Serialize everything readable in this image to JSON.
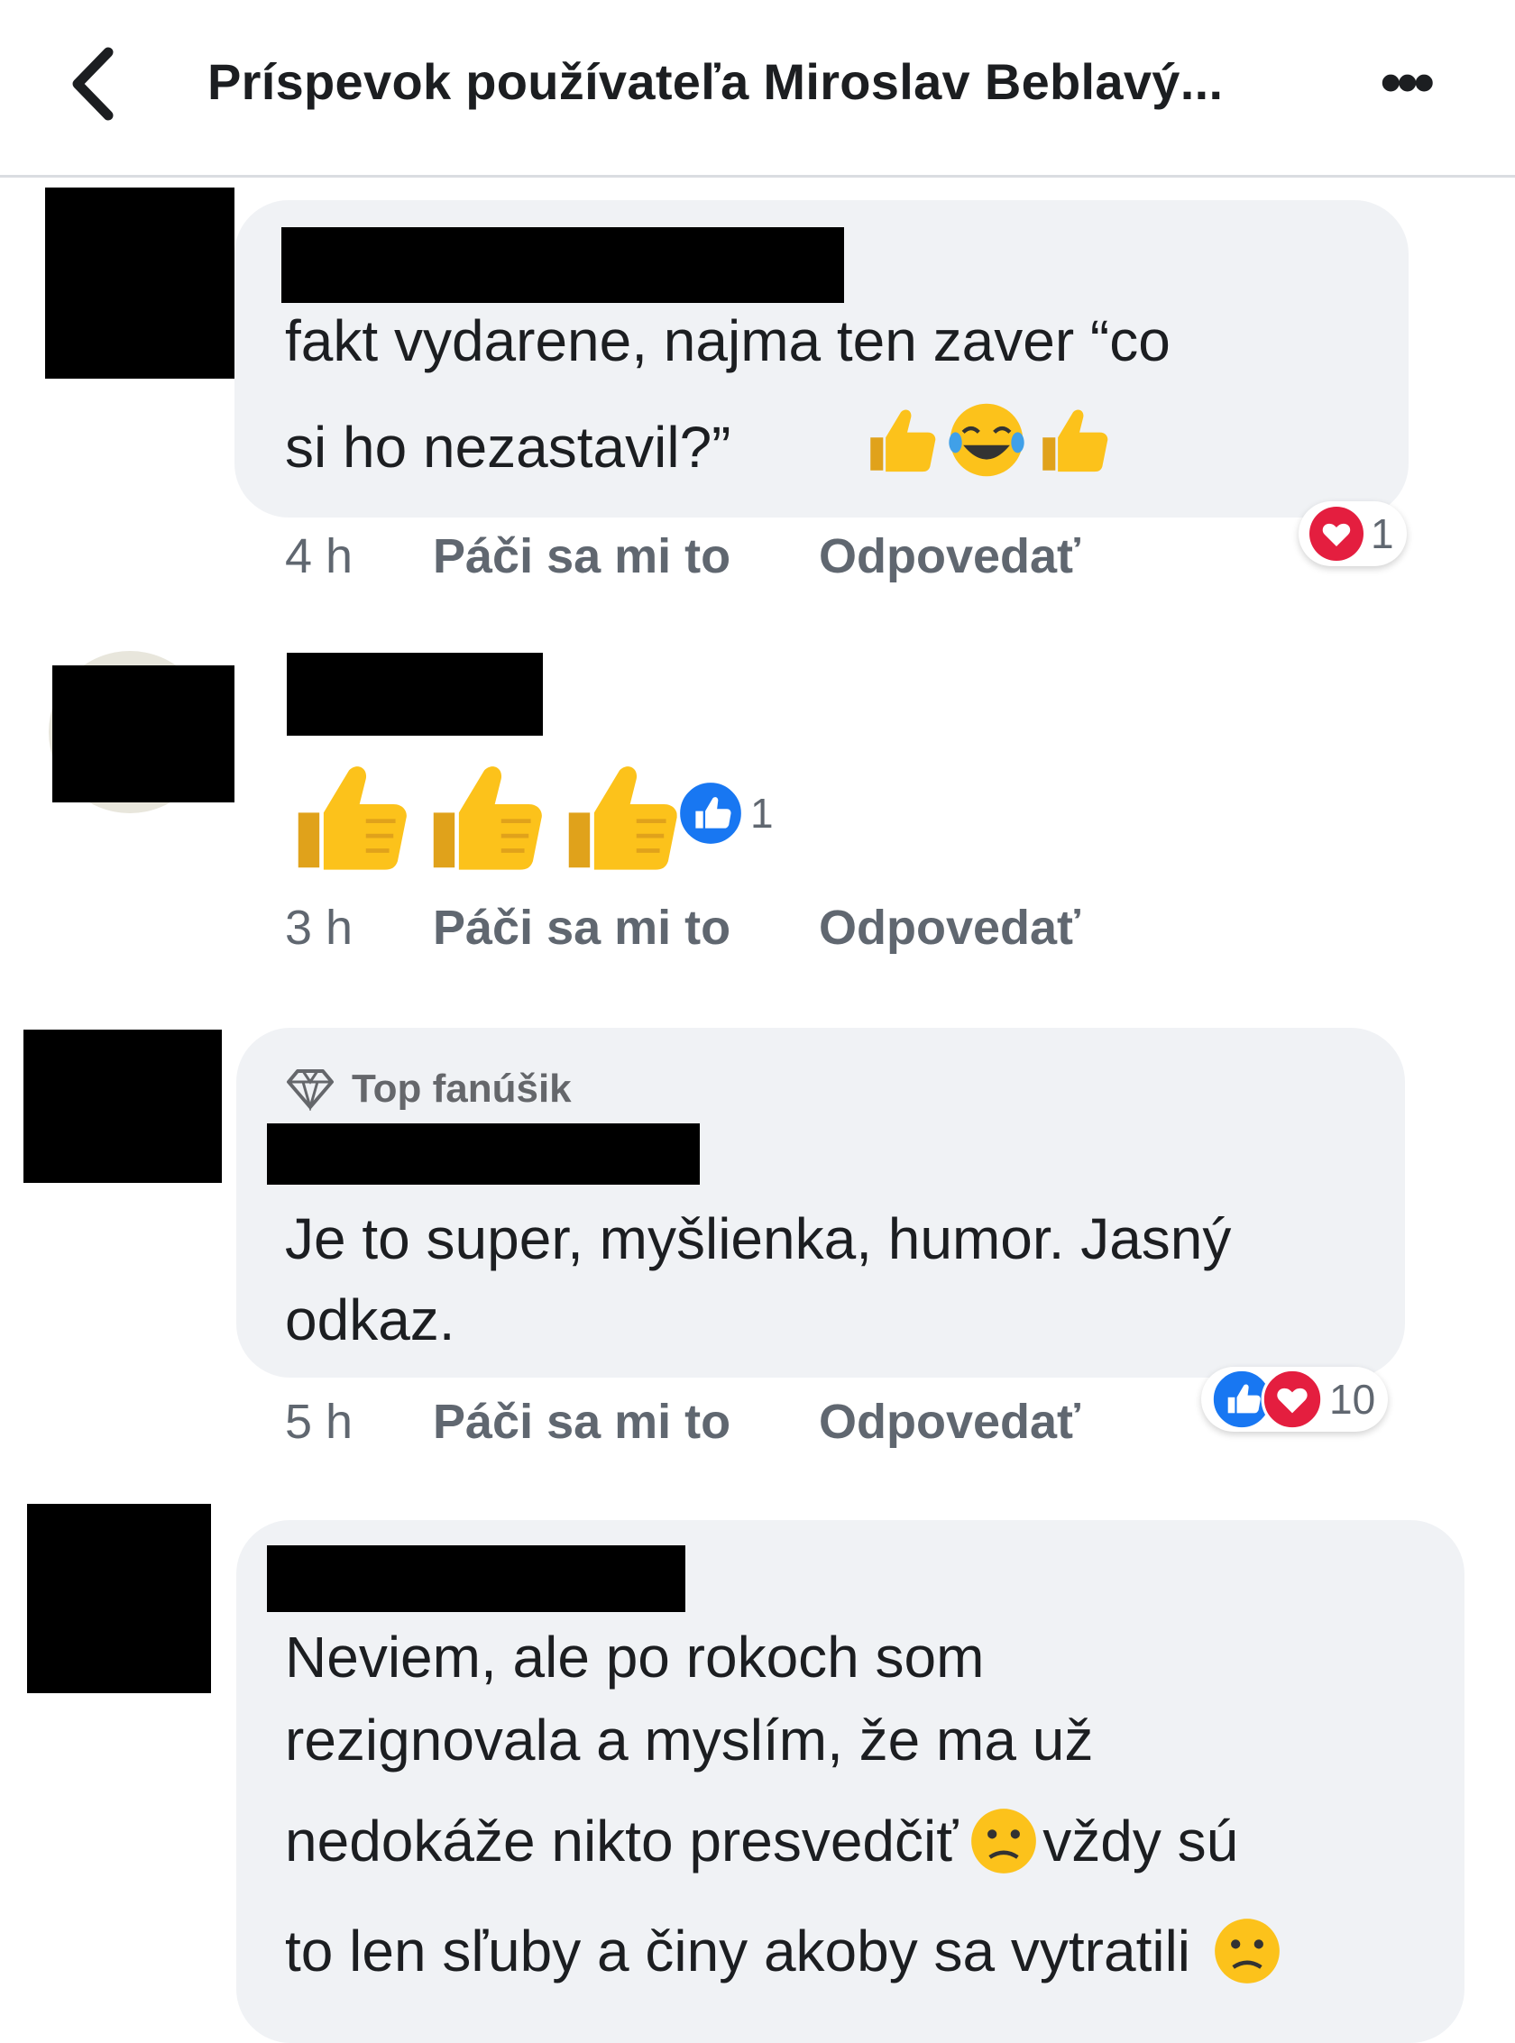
{
  "header": {
    "title": "Príspevok používateľa Miroslav Beblavý...",
    "back_icon": "chevron-left-icon",
    "more_icon": "ellipsis-icon",
    "more_glyph": "•••"
  },
  "comments": [
    {
      "line1": "fakt vydarene,  najma  ten  zaver  “co",
      "line2": "si  ho  nezastavil?”",
      "emojis": [
        "thumbs-up-icon",
        "joy-face-icon",
        "thumbs-up-icon"
      ],
      "time": "4 h",
      "like_label": "Páči sa mi to",
      "reply_label": "Odpovedať",
      "reaction_count": "1",
      "reaction_icons": [
        "heart-icon"
      ]
    },
    {
      "emojis": [
        "thumbs-up-icon",
        "thumbs-up-icon",
        "thumbs-up-icon"
      ],
      "time": "3 h",
      "like_label": "Páči sa mi to",
      "reply_label": "Odpovedať",
      "reaction_count": "1",
      "reaction_icons": [
        "like-icon"
      ]
    },
    {
      "badge": "Top fanúšik",
      "badge_icon": "diamond-icon",
      "line1": "Je to super, myšlienka, humor. Jasný",
      "line2": "odkaz.",
      "time": "5 h",
      "like_label": "Páči sa mi to",
      "reply_label": "Odpovedať",
      "reaction_count": "10",
      "reaction_icons": [
        "like-icon",
        "heart-icon"
      ]
    },
    {
      "line1": "Neviem, ale po rokoch som",
      "line2": "rezignovala a myslím, že ma už",
      "line3a": "nedokáže nikto presvedčiť",
      "line3b": "vždy sú",
      "line4": "to len sľuby a činy akoby sa vytratili",
      "emojis": [
        "confused-face-icon",
        "confused-face-icon"
      ]
    }
  ],
  "colors": {
    "bubble": "#f0f2f5",
    "meta_text": "#606770",
    "like_blue": "#1877f2",
    "heart_red": "#e41e3f"
  }
}
